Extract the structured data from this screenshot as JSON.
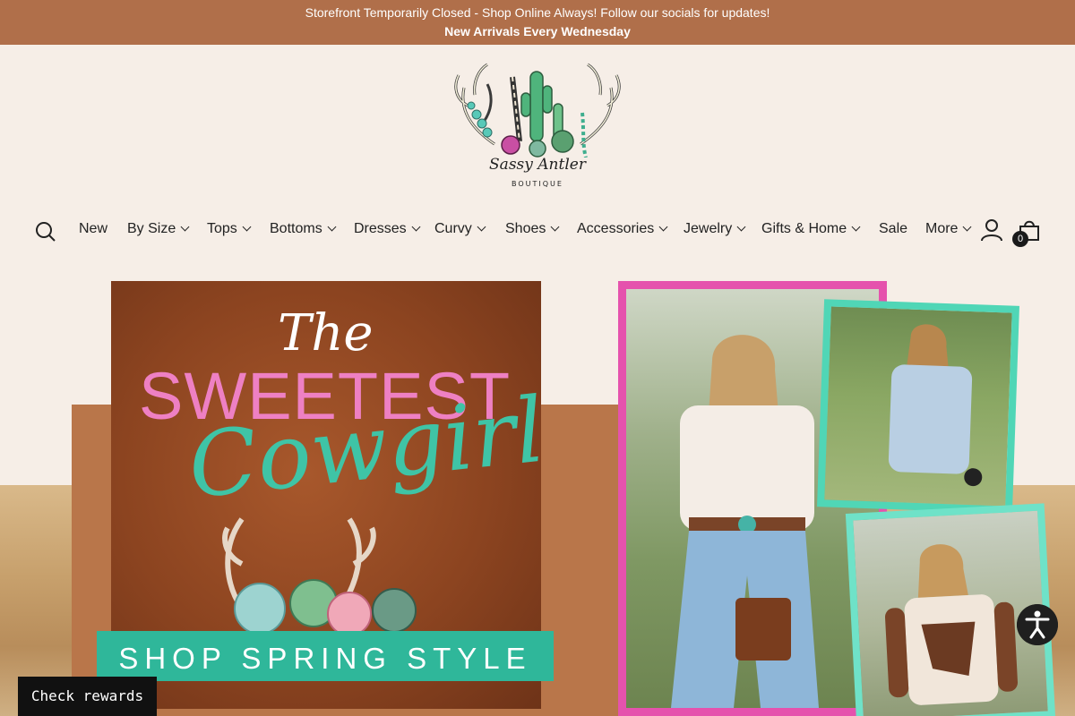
{
  "announcement": {
    "line1": "Storefront Temporarily Closed - Shop Online Always! Follow our socials for updates!",
    "line2": "New Arrivals Every Wednesday"
  },
  "logo": {
    "name": "Sassy Antler",
    "sub": "BOUTIQUE"
  },
  "nav": {
    "items": [
      {
        "label": "New",
        "dropdown": false
      },
      {
        "label": "By Size",
        "dropdown": true
      },
      {
        "label": "Tops",
        "dropdown": true
      },
      {
        "label": "Bottoms",
        "dropdown": true
      },
      {
        "label": "Dresses",
        "dropdown": true
      },
      {
        "label": "Curvy",
        "dropdown": true
      },
      {
        "label": "Shoes",
        "dropdown": true
      },
      {
        "label": "Accessories",
        "dropdown": true
      },
      {
        "label": "Jewelry",
        "dropdown": true
      },
      {
        "label": "Gifts & Home",
        "dropdown": true
      },
      {
        "label": "Sale",
        "dropdown": false
      },
      {
        "label": "More",
        "dropdown": true
      }
    ],
    "cart_count": "0",
    "icons": [
      "search-icon",
      "account-icon",
      "cart-icon"
    ]
  },
  "hero": {
    "line_the": "The",
    "line_sweetest": "SWEETEST",
    "line_cowgirl": "Cowgirl",
    "banner": "SHOP SPRING STYLE"
  },
  "widgets": {
    "rewards_label": "Check rewards",
    "accessibility_icon": "accessibility-icon"
  },
  "colors": {
    "announcement_bg": "#b06f4a",
    "page_bg": "#f6eee7",
    "pink": "#ee80c3",
    "teal": "#3fc4a6",
    "frame_pink": "#e552ad",
    "frame_teal": "#50d6b6"
  }
}
